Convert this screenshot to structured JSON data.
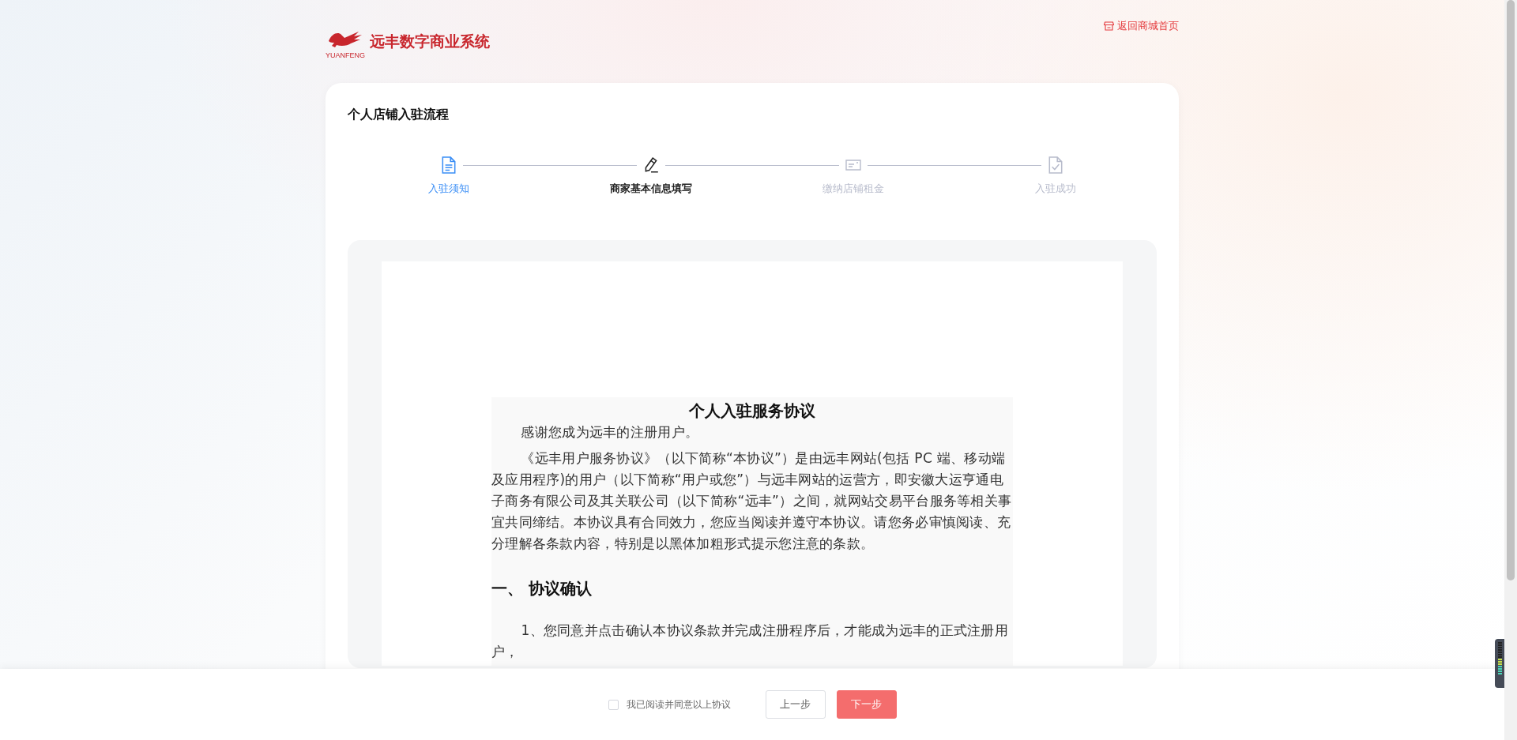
{
  "header": {
    "logo_mark_text": "YUANFENG",
    "brand": "远丰数字商业系统",
    "home_link": "返回商城首页"
  },
  "card": {
    "title": "个人店铺入驻流程",
    "steps": [
      {
        "label": "入驻须知",
        "completed": true,
        "selected": false
      },
      {
        "label": "商家基本信息填写",
        "completed": false,
        "selected": true
      },
      {
        "label": "缴纳店铺租金",
        "completed": false,
        "selected": false
      },
      {
        "label": "入驻成功",
        "completed": false,
        "selected": false
      }
    ],
    "agreement": {
      "title": "个人入驻服务协议",
      "blocks": [
        {
          "kind": "paragraph",
          "text": "感谢您成为远丰的注册用户。"
        },
        {
          "kind": "paragraph",
          "text": "《远丰用户服务协议》（以下简称“本协议”）是由远丰网站(包括 PC 端、移动端及应用程序)的用户（以下简称“用户或您”）与远丰网站的运营方，即安徽大运亨通电子商务有限公司及其关联公司（以下简称“远丰”）之间，就网站交易平台服务等相关事宜共同缔结。本协议具有合同效力，您应当阅读并遵守本协议。请您务必审慎阅读、充分理解各条款内容，特别是以黑体加粗形式提示您注意的条款。"
        },
        {
          "kind": "heading",
          "text": "一、 协议确认"
        },
        {
          "kind": "paragraph",
          "text": "1、您同意并点击确认本协议条款并完成注册程序后，才能成为远丰的正式注册用户，"
        }
      ]
    }
  },
  "footer": {
    "agree": {
      "label": "我已阅读并同意以上协议",
      "checked": false
    },
    "prev_button": "上一步",
    "next_button": "下一步"
  }
}
